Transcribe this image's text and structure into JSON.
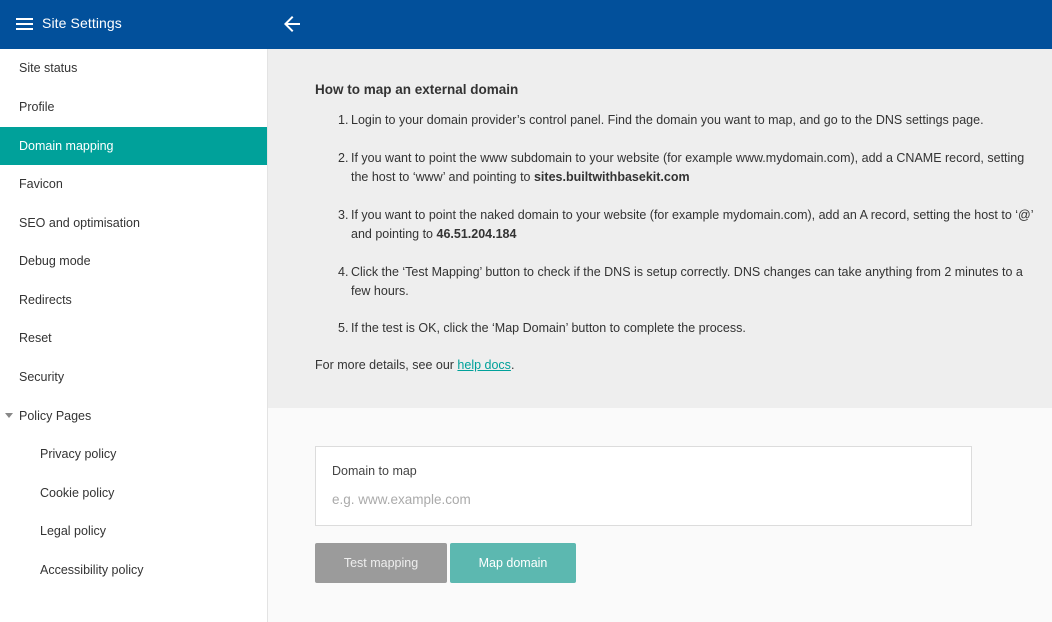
{
  "header": {
    "title": "Site Settings",
    "menu_icon": "hamburger-menu-icon",
    "back_icon": "arrow-left-icon",
    "background": "#02509b"
  },
  "sidebar": {
    "active_color": "#00a19a",
    "items": [
      {
        "label": "Site status"
      },
      {
        "label": "Profile"
      },
      {
        "label": "Domain mapping",
        "active": true
      },
      {
        "label": "Favicon"
      },
      {
        "label": "SEO and optimisation"
      },
      {
        "label": "Debug mode"
      },
      {
        "label": "Redirects"
      },
      {
        "label": "Reset"
      },
      {
        "label": "Security"
      },
      {
        "label": "Policy Pages",
        "expanded": true,
        "icon": "caret-down-icon"
      }
    ],
    "sub_items": [
      {
        "label": "Privacy policy"
      },
      {
        "label": "Cookie policy"
      },
      {
        "label": "Legal policy"
      },
      {
        "label": "Accessibility policy"
      }
    ]
  },
  "instructions": {
    "title": "How to map an external domain",
    "steps": [
      {
        "num": "1.",
        "text": "Login to your domain provider’s control panel. Find the domain you want to map, and go to the DNS settings page."
      },
      {
        "num": "2.",
        "text": "If you want to point the www subdomain to your website (for example www.mydomain.com), add a CNAME record, setting the host to ‘www’ and pointing to ",
        "bold": "sites.builtwithbasekit.com"
      },
      {
        "num": "3.",
        "text": "If you want to point the naked domain to your website (for example mydomain.com), add an A record, setting the host to ‘@’ and pointing to ",
        "bold": "46.51.204.184"
      },
      {
        "num": "4.",
        "text": "Click the ‘Test Mapping’ button to check if the DNS is setup correctly. DNS changes can take anything from 2 minutes to a few hours."
      },
      {
        "num": "5.",
        "text": "If the test is OK, click the ‘Map Domain’ button to complete the process."
      }
    ],
    "more_prefix": "For more details, see our ",
    "more_link": "help docs",
    "more_suffix": "."
  },
  "form": {
    "label": "Domain to map",
    "value": "",
    "placeholder": "e.g. www.example.com"
  },
  "buttons": {
    "test_label": "Test mapping",
    "map_label": "Map domain",
    "map_color": "#5cb8b0"
  }
}
